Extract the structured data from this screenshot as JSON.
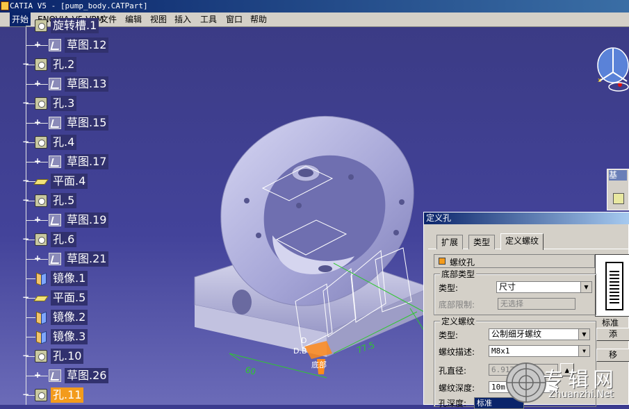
{
  "window": {
    "title": "CATIA V5 - [pump_body.CATPart]"
  },
  "menu": [
    "开始",
    "ENOVIA V5 VPM",
    "文件",
    "编辑",
    "视图",
    "插入",
    "工具",
    "窗口",
    "帮助"
  ],
  "tree": [
    {
      "label": "旋转槽.1",
      "icon": "hole-icon",
      "plus": false,
      "indent": 1
    },
    {
      "label": "草图.12",
      "icon": "sketch-icon",
      "plus": true,
      "indent": 2
    },
    {
      "label": "孔.2",
      "icon": "hole-icon",
      "plus": true,
      "indent": 1
    },
    {
      "label": "草图.13",
      "icon": "sketch-icon",
      "plus": true,
      "indent": 2
    },
    {
      "label": "孔.3",
      "icon": "hole-icon",
      "plus": true,
      "indent": 1
    },
    {
      "label": "草图.15",
      "icon": "sketch-icon",
      "plus": true,
      "indent": 2
    },
    {
      "label": "孔.4",
      "icon": "hole-icon",
      "plus": true,
      "indent": 1
    },
    {
      "label": "草图.17",
      "icon": "sketch-icon",
      "plus": true,
      "indent": 2
    },
    {
      "label": "平面.4",
      "icon": "plane-icon",
      "plus": true,
      "indent": 1
    },
    {
      "label": "孔.5",
      "icon": "hole-icon",
      "plus": true,
      "indent": 1
    },
    {
      "label": "草图.19",
      "icon": "sketch-icon",
      "plus": true,
      "indent": 2
    },
    {
      "label": "孔.6",
      "icon": "hole-icon",
      "plus": true,
      "indent": 1
    },
    {
      "label": "草图.21",
      "icon": "sketch-icon",
      "plus": true,
      "indent": 2
    },
    {
      "label": "镜像.1",
      "icon": "mirror-icon",
      "plus": false,
      "indent": 1
    },
    {
      "label": "平面.5",
      "icon": "plane-icon",
      "plus": true,
      "indent": 1
    },
    {
      "label": "镜像.2",
      "icon": "mirror-icon",
      "plus": false,
      "indent": 1
    },
    {
      "label": "镜像.3",
      "icon": "mirror-icon",
      "plus": false,
      "indent": 1
    },
    {
      "label": "孔.10",
      "icon": "hole-icon",
      "plus": true,
      "indent": 1
    },
    {
      "label": "草图.26",
      "icon": "sketch-icon",
      "plus": true,
      "indent": 2
    },
    {
      "label": "孔.11",
      "icon": "hole-icon",
      "plus": true,
      "indent": 1,
      "selected": true
    }
  ],
  "viewport": {
    "dims": {
      "d1": "60",
      "d2": "77.5",
      "d3": "D",
      "d4": "D.B",
      "d5": "底部"
    }
  },
  "side_panel": {
    "title": "基"
  },
  "dialog": {
    "title": "定义孔",
    "tabs": [
      "扩展",
      "类型",
      "定义螺纹"
    ],
    "active_tab": 2,
    "threaded_checkbox": "螺纹孔",
    "threaded_checked": true,
    "bottom_group": "底部类型",
    "bottom_type_label": "类型:",
    "bottom_type_value": "尺寸",
    "bottom_limit_label": "底部限制:",
    "bottom_limit_value": "无选择",
    "thread_group": "定义螺纹",
    "thread_type_label": "类型:",
    "thread_type_value": "公制细牙螺纹",
    "thread_desc_label": "螺纹描述:",
    "thread_desc_value": "M8x1",
    "hole_dia_label": "孔直径:",
    "hole_dia_value": "6.917",
    "thread_depth_label": "螺纹深度:",
    "thread_depth_value": "10m",
    "hole_depth_label": "孔深度:",
    "hole_depth_value": "标准",
    "standard_label": "标准",
    "add_button": "添",
    "remove_button": "移"
  },
  "watermark": {
    "cn": "专辑网",
    "en": "Zhuanzhi.Net"
  }
}
